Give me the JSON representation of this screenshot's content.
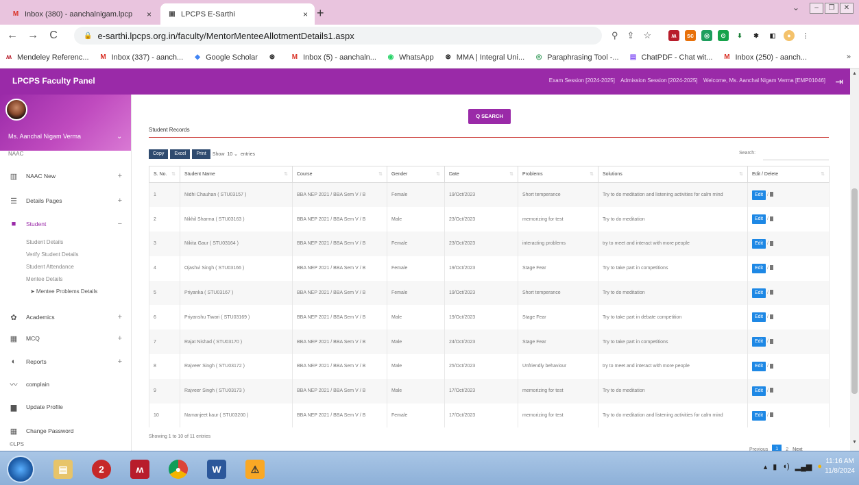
{
  "browser": {
    "tabs": [
      {
        "title": "Inbox (380) - aanchalnigam.lpcp",
        "close": "×",
        "favicon": "M"
      },
      {
        "title": "LPCPS E-Sarthi",
        "close": "×",
        "favicon": "▣"
      }
    ],
    "new_tab": "+",
    "url": "e-sarthi.lpcps.org.in/faculty/MentorMenteeAllotmentDetails1.aspx",
    "nav": {
      "back": "←",
      "forward": "→",
      "reload": "C"
    },
    "bookmarks": [
      {
        "label": "Mendeley Referenc...",
        "icon": "ʍ",
        "color": "#b81d2b"
      },
      {
        "label": "Inbox (337) - aanch...",
        "icon": "M",
        "color": "#d93025"
      },
      {
        "label": "Google Scholar",
        "icon": "◆",
        "color": "#4285f4"
      },
      {
        "label": "",
        "icon": "⊛",
        "color": "#222"
      },
      {
        "label": "Inbox (5) - aanchaln...",
        "icon": "M",
        "color": "#d93025"
      },
      {
        "label": "WhatsApp",
        "icon": "◉",
        "color": "#25d366"
      },
      {
        "label": "MMA | Integral Uni...",
        "icon": "⊛",
        "color": "#222"
      },
      {
        "label": "Paraphrasing Tool -...",
        "icon": "◎",
        "color": "#3a9d5d"
      },
      {
        "label": "ChatPDF - Chat wit...",
        "icon": "▤",
        "color": "#8b5cf6"
      },
      {
        "label": "Inbox (250) - aanch...",
        "icon": "M",
        "color": "#d93025"
      }
    ],
    "bookmarks_more": "»"
  },
  "topbar": {
    "brand": "LPCPS Faculty Panel",
    "exam_session": "Exam Session [2024-2025]",
    "admission_session": "Admission Session [2024-2025]",
    "welcome": "Welcome, Ms. Aanchal Nigam Verma [EMP01046]"
  },
  "sidebar": {
    "user_name": "Ms. Aanchal Nigam Verma",
    "partial_item": "NAAC",
    "items": [
      {
        "label": "NAAC New",
        "icon": "▥",
        "toggle": "+"
      },
      {
        "label": "Details Pages",
        "icon": "☰",
        "toggle": "+"
      },
      {
        "label": "Student",
        "icon": "■",
        "toggle": "−"
      },
      {
        "label": "Academics",
        "icon": "✿",
        "toggle": "+"
      },
      {
        "label": "MCQ",
        "icon": "▦",
        "toggle": "+"
      },
      {
        "label": "Reports",
        "icon": "◐",
        "toggle": "+"
      },
      {
        "label": "complain",
        "icon": "〰",
        "toggle": ""
      },
      {
        "label": "Update Profile",
        "icon": "▆",
        "toggle": ""
      },
      {
        "label": "Change Password",
        "icon": "▦",
        "toggle": ""
      }
    ],
    "sub_items": [
      "Student Details",
      "Verify Student Details",
      "Student Attendance",
      "Mentee Details",
      "➤ Mentee Problems Details"
    ],
    "footer": "©LPS"
  },
  "content": {
    "search_button": "Q  SEARCH",
    "section_title": "Student Records",
    "buttons": {
      "copy": "Copy",
      "excel": "Excel",
      "print": "Print"
    },
    "show_label": "Show",
    "page_length": "10",
    "entries_label": "entries",
    "search_label": "Search:",
    "columns": [
      "S. No.",
      "Student Name",
      "Course",
      "Gender",
      "Date",
      "Problems",
      "Solutions",
      "Edit / Delete"
    ],
    "edit_label": "Edit",
    "rows": [
      [
        "1",
        "Nidhi Chauhan ( STU03157 )",
        "BBA NEP 2021 / BBA Sem V / B",
        "Female",
        "19/Oct/2023",
        "Short temperance",
        "Try to do meditation and listening activities for calm mind"
      ],
      [
        "2",
        "Nikhil Sharma ( STU03163 )",
        "BBA NEP 2021 / BBA Sem V / B",
        "Male",
        "23/Oct/2023",
        "memorizing for test",
        "Try to do meditation"
      ],
      [
        "3",
        "Nikita Gaur ( STU03164 )",
        "BBA NEP 2021 / BBA Sem V / B",
        "Female",
        "23/Oct/2023",
        "interacting problems",
        "try to meet and interact with more people"
      ],
      [
        "4",
        "Ojashvi Singh ( STU03166 )",
        "BBA NEP 2021 / BBA Sem V / B",
        "Female",
        "19/Oct/2023",
        "Stage Fear",
        "Try to take part in competitions"
      ],
      [
        "5",
        "Priyanka ( STU03167 )",
        "BBA NEP 2021 / BBA Sem V / B",
        "Female",
        "19/Oct/2023",
        "Short temperance",
        "Try to do meditation"
      ],
      [
        "6",
        "Priyanshu Tiwari ( STU03169 )",
        "BBA NEP 2021 / BBA Sem V / B",
        "Male",
        "19/Oct/2023",
        "Stage Fear",
        "Try to take part in debate competition"
      ],
      [
        "7",
        "Rajat Nishad ( STU03170 )",
        "BBA NEP 2021 / BBA Sem V / B",
        "Male",
        "24/Oct/2023",
        "Stage Fear",
        "Try to take part in competitions"
      ],
      [
        "8",
        "Rajveer Singh ( STU03172 )",
        "BBA NEP 2021 / BBA Sem V / B",
        "Male",
        "25/Oct/2023",
        "Unfriendly behaviour",
        "try to meet and interact with more people"
      ],
      [
        "9",
        "Rajveer Singh ( STU03173 )",
        "BBA NEP 2021 / BBA Sem V / B",
        "Male",
        "17/Oct/2023",
        "memorizing for test",
        "Try to do meditation"
      ],
      [
        "10",
        "Namanjeet kaur ( STU03200 )",
        "BBA NEP 2021 / BBA Sem V / B",
        "Female",
        "17/Oct/2023",
        "memorizing for test",
        "Try to do meditation and listening activities for calm mind"
      ]
    ],
    "info": "Showing 1 to 10 of 11 entries",
    "pager": {
      "previous": "Previous",
      "pages": [
        "1",
        "2"
      ],
      "next": "Next"
    }
  },
  "taskbar": {
    "time": "11:16 AM",
    "date": "11/8/2024"
  },
  "colors": {
    "brand": "#9a2aa8",
    "edit": "#1e88e5",
    "accent_line": "#c9302c"
  }
}
